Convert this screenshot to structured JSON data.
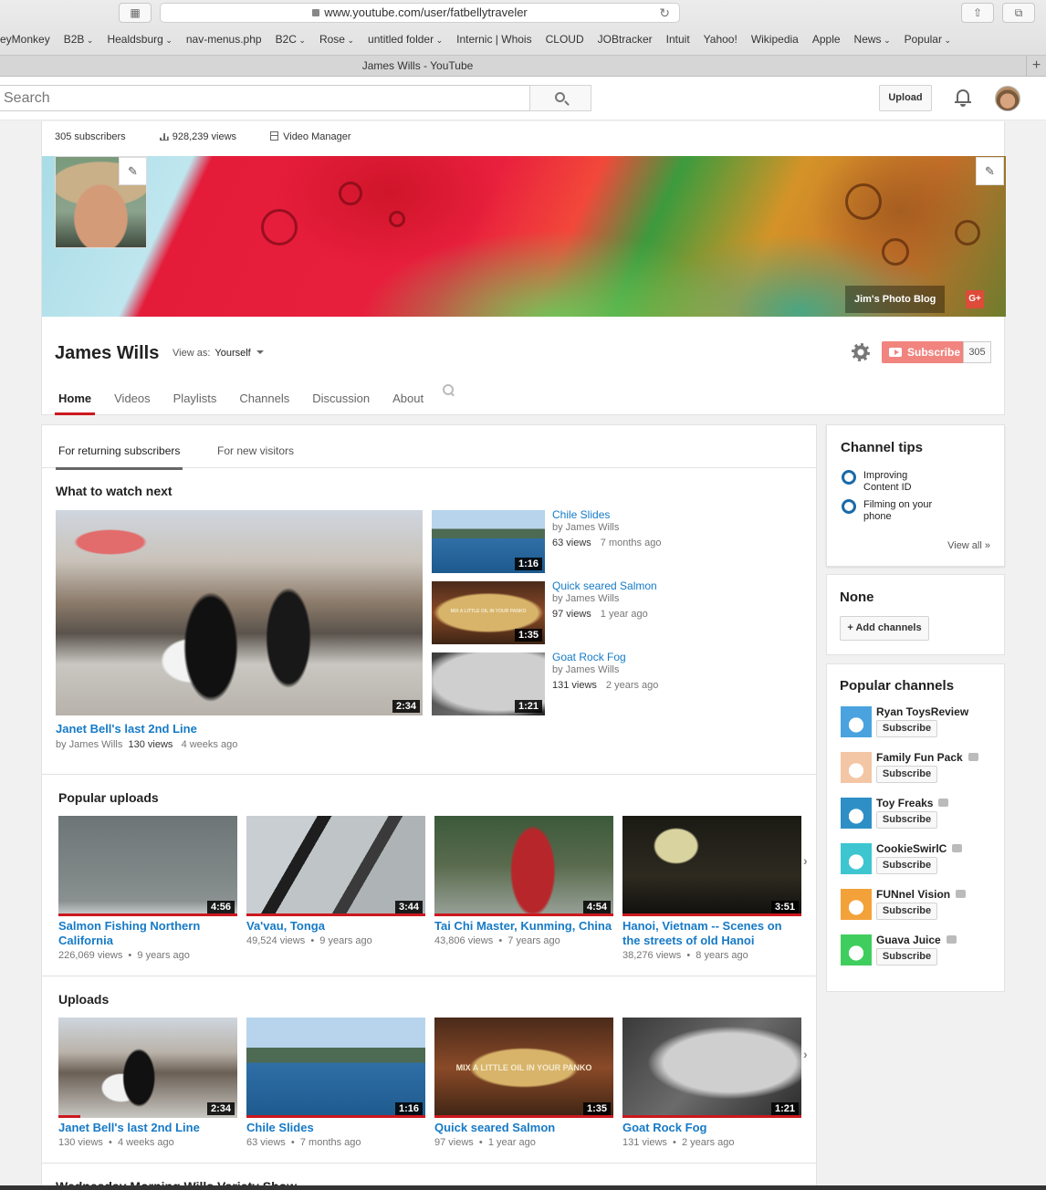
{
  "browser": {
    "url": "www.youtube.com/user/fatbellytraveler",
    "tab_title": "James Wills - YouTube",
    "bookmarks": [
      {
        "label": "eyMonkey",
        "dropdown": false
      },
      {
        "label": "B2B",
        "dropdown": true
      },
      {
        "label": "Healdsburg",
        "dropdown": true
      },
      {
        "label": "nav-menus.php",
        "dropdown": false
      },
      {
        "label": "B2C",
        "dropdown": true
      },
      {
        "label": "Rose",
        "dropdown": true
      },
      {
        "label": "untitled folder",
        "dropdown": true
      },
      {
        "label": "Internic | Whois",
        "dropdown": false
      },
      {
        "label": "CLOUD",
        "dropdown": false
      },
      {
        "label": "JOBtracker",
        "dropdown": false
      },
      {
        "label": "Intuit",
        "dropdown": false
      },
      {
        "label": "Yahoo!",
        "dropdown": false
      },
      {
        "label": "Wikipedia",
        "dropdown": false
      },
      {
        "label": "Apple",
        "dropdown": false
      },
      {
        "label": "News",
        "dropdown": true
      },
      {
        "label": "Popular",
        "dropdown": true
      }
    ]
  },
  "masthead": {
    "search_placeholder": "Search",
    "upload_label": "Upload"
  },
  "channel": {
    "subscribers_text": "305 subscribers",
    "views_text": "928,239 views",
    "video_manager_label": "Video Manager",
    "name": "James Wills",
    "view_as_label": "View as:",
    "view_as_value": "Yourself",
    "blog_link": "Jim's Photo Blog",
    "gplus_label": "G+",
    "subscribe_label": "Subscribe",
    "subscribe_count": "305",
    "tabs": [
      "Home",
      "Videos",
      "Playlists",
      "Channels",
      "Discussion",
      "About"
    ]
  },
  "main": {
    "subtabs": [
      "For returning subscribers",
      "For new visitors"
    ],
    "what_to_watch": {
      "title": "What to watch next",
      "featured": {
        "title": "Janet Bell's last 2nd Line",
        "by": "by James Wills",
        "views": "130 views",
        "age": "4 weeks ago",
        "duration": "2:34"
      },
      "side": [
        {
          "title": "Chile Slides",
          "by": "by James Wills",
          "views": "63 views",
          "age": "7 months ago",
          "duration": "1:16"
        },
        {
          "title": "Quick seared Salmon",
          "by": "by James Wills",
          "views": "97 views",
          "age": "1 year ago",
          "duration": "1:35",
          "overlay": "MIX A LITTLE OIL IN YOUR PANKO"
        },
        {
          "title": "Goat Rock Fog",
          "by": "by James Wills",
          "views": "131 views",
          "age": "2 years ago",
          "duration": "1:21"
        }
      ]
    },
    "popular": {
      "title": "Popular uploads",
      "items": [
        {
          "title": "Salmon Fishing Northern California",
          "meta": "226,069 views  •  9 years ago",
          "duration": "4:56"
        },
        {
          "title": "Va'vau, Tonga",
          "meta": "49,524 views  •  9 years ago",
          "duration": "3:44"
        },
        {
          "title": "Tai Chi Master, Kunming, China",
          "meta": "43,806 views  •  7 years ago",
          "duration": "4:54"
        },
        {
          "title": "Hanoi, Vietnam -- Scenes on the streets of old Hanoi",
          "meta": "38,276 views  •  8 years ago",
          "duration": "3:51"
        }
      ]
    },
    "uploads": {
      "title": "Uploads",
      "items": [
        {
          "title": "Janet Bell's last 2nd Line",
          "meta": "130 views  •  4 weeks ago",
          "duration": "2:34"
        },
        {
          "title": "Chile Slides",
          "meta": "63 views  •  7 months ago",
          "duration": "1:16"
        },
        {
          "title": "Quick seared Salmon",
          "meta": "97 views  •  1 year ago",
          "duration": "1:35",
          "overlay": "MIX A LITTLE OIL IN YOUR PANKO"
        },
        {
          "title": "Goat Rock Fog",
          "meta": "131 views  •  2 years ago",
          "duration": "1:21"
        }
      ]
    },
    "next_section_title": "Wednesday Morning Wills Variety Show"
  },
  "sidebar": {
    "tips": {
      "title": "Channel tips",
      "items": [
        "Improving Content ID",
        "Filming on your phone"
      ],
      "view_all": "View all »"
    },
    "featured": {
      "title": "None",
      "add_label": "+ Add channels"
    },
    "popular_channels": {
      "title": "Popular channels",
      "subscribe_label": "Subscribe",
      "items": [
        {
          "name": "Ryan ToysReview",
          "verified": false,
          "color": "#4aa3df"
        },
        {
          "name": "Family Fun Pack",
          "verified": true,
          "color": "#f3c6a5"
        },
        {
          "name": "Toy Freaks",
          "verified": true,
          "color": "#2e8fc7"
        },
        {
          "name": "CookieSwirlC",
          "verified": true,
          "color": "#3dc6d0"
        },
        {
          "name": "FUNnel Vision",
          "verified": true,
          "color": "#f3a23a"
        },
        {
          "name": "Guava Juice",
          "verified": true,
          "color": "#3fce5e"
        }
      ]
    }
  },
  "colors": {
    "link": "#167ac6",
    "youtube_red": "#cc181e",
    "subscribe": "#e62117"
  }
}
